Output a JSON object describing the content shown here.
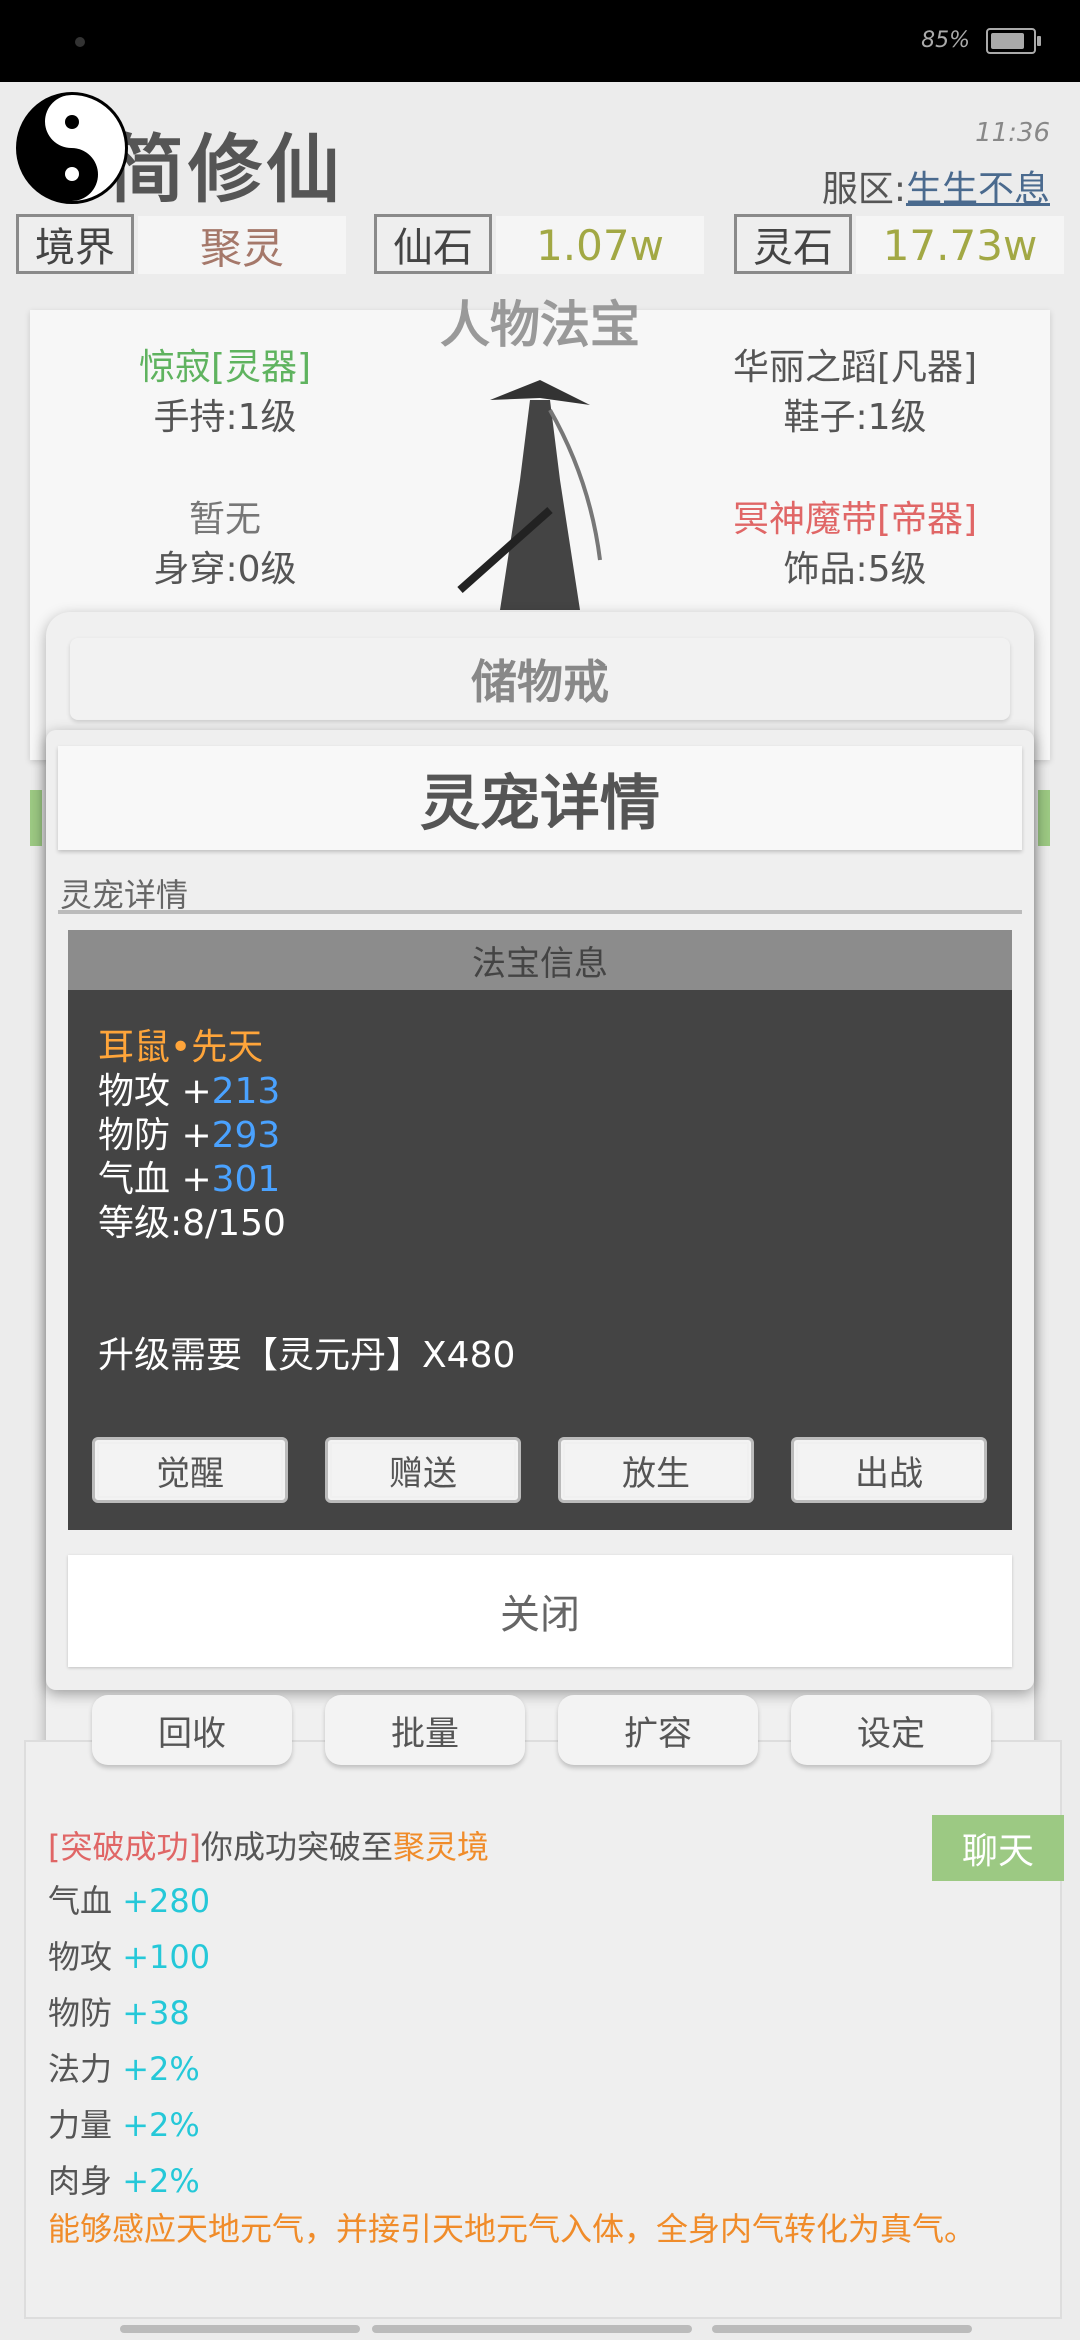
{
  "status_bar": {
    "battery_text": "85%"
  },
  "header": {
    "title": "简修仙",
    "clock": "11:36",
    "server_label": "服区:",
    "server_value": "生生不息"
  },
  "stats_row": [
    {
      "label": "境界",
      "value": "聚灵"
    },
    {
      "label": "仙石",
      "value": "1.07w"
    },
    {
      "label": "灵石",
      "value": "17.73w"
    }
  ],
  "equipment": {
    "title": "人物法宝",
    "weapon_name": "惊寂[灵器]",
    "weapon_slot": "手持:1级",
    "shoes_name": "华丽之蹈[凡器]",
    "shoes_slot": "鞋子:1级",
    "armor_name": "暂无",
    "armor_slot": "身穿:0级",
    "accessory_name": "冥神魔带[帝器]",
    "accessory_slot": "饰品:5级"
  },
  "storage": {
    "title": "储物戒",
    "buttons": [
      "回收",
      "批量",
      "扩容",
      "设定"
    ]
  },
  "modal": {
    "title": "灵宠详情",
    "subtitle": "灵宠详情",
    "info_header": "法宝信息",
    "pet_name": "耳鼠•先天",
    "atk_label": "物攻 +",
    "atk_value": "213",
    "def_label": "物防 +",
    "def_value": "293",
    "hp_label": "气血 +",
    "hp_value": "301",
    "level": "等级:8/150",
    "upgrade_req": "升级需要【灵元丹】X480",
    "buttons": [
      "觉醒",
      "赠送",
      "放生",
      "出战"
    ],
    "close": "关闭"
  },
  "log": {
    "breakthrough_tag": "[突破成功]",
    "breakthrough_text": "你成功突破至",
    "breakthrough_realm": "聚灵境",
    "lines": [
      {
        "label": "气血",
        "value": "+280"
      },
      {
        "label": "物攻",
        "value": "+100"
      },
      {
        "label": "物防",
        "value": "+38"
      },
      {
        "label": "法力",
        "value": "+2%"
      },
      {
        "label": "力量",
        "value": "+2%"
      },
      {
        "label": "肉身",
        "value": "+2%"
      }
    ],
    "description": "能够感应天地元气，并接引天地元气入体，全身内气转化为真气。",
    "chat_button": "聊天"
  },
  "colors": {
    "weapon": "#5fb35f",
    "accessory": "#e06666",
    "gold": "#a2a844",
    "stat_blue": "#4aa2ff",
    "log_cyan": "#25c8d8",
    "orange": "#f08c2a"
  }
}
